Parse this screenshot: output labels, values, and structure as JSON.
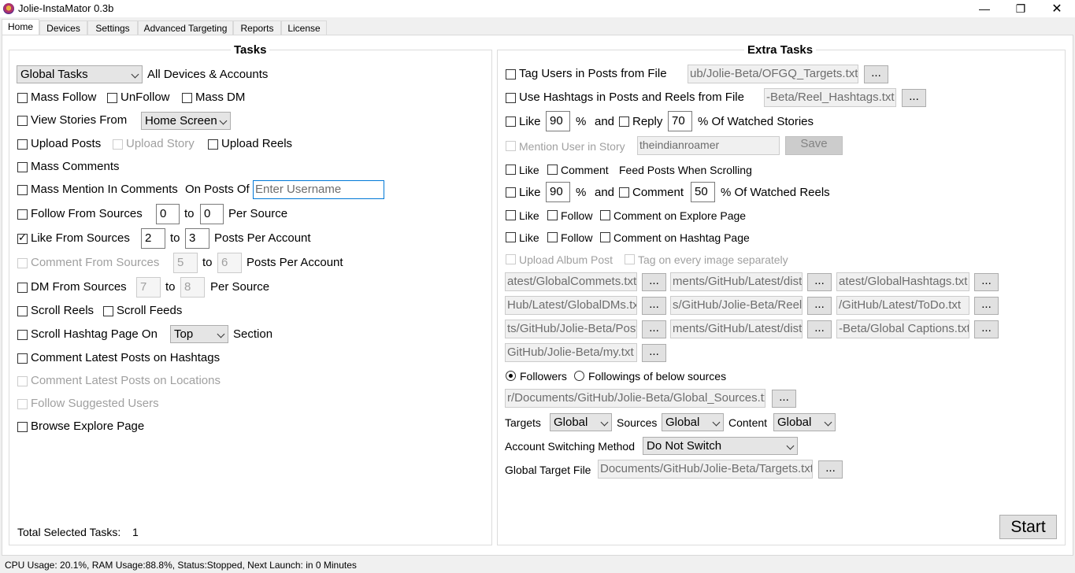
{
  "window": {
    "title": "Jolie-InstaMator 0.3b"
  },
  "tabs": [
    "Home",
    "Devices",
    "Settings",
    "Advanced Targeting",
    "Reports",
    "License"
  ],
  "tasks": {
    "title": "Tasks",
    "global_combo": "Global Tasks",
    "all_devices_label": "All Devices & Accounts",
    "mass_follow": "Mass Follow",
    "unfollow": "UnFollow",
    "mass_dm": "Mass DM",
    "view_stories": "View Stories From",
    "view_stories_combo": "Home Screen",
    "upload_posts": "Upload Posts",
    "upload_story": "Upload Story",
    "upload_reels": "Upload Reels",
    "mass_comments": "Mass Comments",
    "mass_mention": "Mass Mention In Comments",
    "on_posts_of": "On Posts Of",
    "username_placeholder": "Enter Username",
    "follow_sources": "Follow From Sources",
    "follow_from": "0",
    "follow_to": "0",
    "to": "to",
    "per_source": "Per Source",
    "like_sources": "Like From Sources",
    "like_from": "2",
    "like_to": "3",
    "posts_per_account": "Posts Per Account",
    "comment_sources": "Comment From Sources",
    "comment_from": "5",
    "comment_to": "6",
    "dm_sources": "DM From Sources",
    "dm_from": "7",
    "dm_to": "8",
    "scroll_reels": "Scroll Reels",
    "scroll_feeds": "Scroll Feeds",
    "scroll_hashtag": "Scroll Hashtag Page On",
    "hashtag_section_combo": "Top",
    "section": "Section",
    "comment_latest_hashtags": "Comment Latest Posts on Hashtags",
    "comment_latest_locations": "Comment Latest Posts on Locations",
    "follow_suggested": "Follow Suggested Users",
    "browse_explore": "Browse Explore Page",
    "total_label": "Total Selected Tasks:",
    "total_value": "1"
  },
  "extra": {
    "title": "Extra Tasks",
    "tag_users": "Tag Users in Posts from File",
    "tag_users_file": "ub/Jolie-Beta/OFGQ_Targets.txt",
    "use_hashtags": "Use Hashtags in Posts and Reels from File",
    "hashtags_file": "-Beta/Reel_Hashtags.txt",
    "browse": "...",
    "like": "Like",
    "story_like_pct": "90",
    "pct": "%",
    "and": "and",
    "reply": "Reply",
    "story_reply_pct": "70",
    "of_watched_stories": "% Of Watched Stories",
    "mention_story": "Mention User in Story",
    "mention_user": "theindianroamer",
    "save": "Save",
    "comment": "Comment",
    "feed_posts_scrolling": "Feed Posts When Scrolling",
    "reel_like_pct": "90",
    "reel_comment_pct": "50",
    "of_watched_reels": "% Of Watched Reels",
    "follow": "Follow",
    "comment_explore": "Comment on Explore Page",
    "comment_hashtag": "Comment on Hashtag Page",
    "upload_album": "Upload Album Post",
    "tag_every_image": "Tag on every image separately",
    "files": [
      "atest/GlobalCommets.txt",
      "ments/GitHub/Latest/dist",
      "atest/GlobalHashtags.txt",
      "Hub/Latest/GlobalDMs.txt",
      "s/GitHub/Jolie-Beta/Reels",
      "/GitHub/Latest/ToDo.txt",
      "ts/GitHub/Jolie-Beta/Post",
      "ments/GitHub/Latest/dist",
      "-Beta/Global Captions.txt",
      "GitHub/Jolie-Beta/my.txt"
    ],
    "followers": "Followers",
    "followings": "Followings of below sources",
    "sources_file": "r/Documents/GitHub/Jolie-Beta/Global_Sources.txt",
    "targets_label": "Targets",
    "targets_combo": "Global",
    "sources_label": "Sources",
    "sources_combo": "Global",
    "content_label": "Content",
    "content_combo": "Global",
    "switching_label": "Account Switching Method",
    "switching_combo": "Do Not Switch",
    "global_target_label": "Global Target File",
    "global_target_file": "Documents/GitHub/Jolie-Beta/Targets.txt",
    "start": "Start"
  },
  "status": {
    "text": "CPU Usage: 20.1%, RAM Usage:88.8%, Status:Stopped, Next Launch: in 0 Minutes"
  }
}
